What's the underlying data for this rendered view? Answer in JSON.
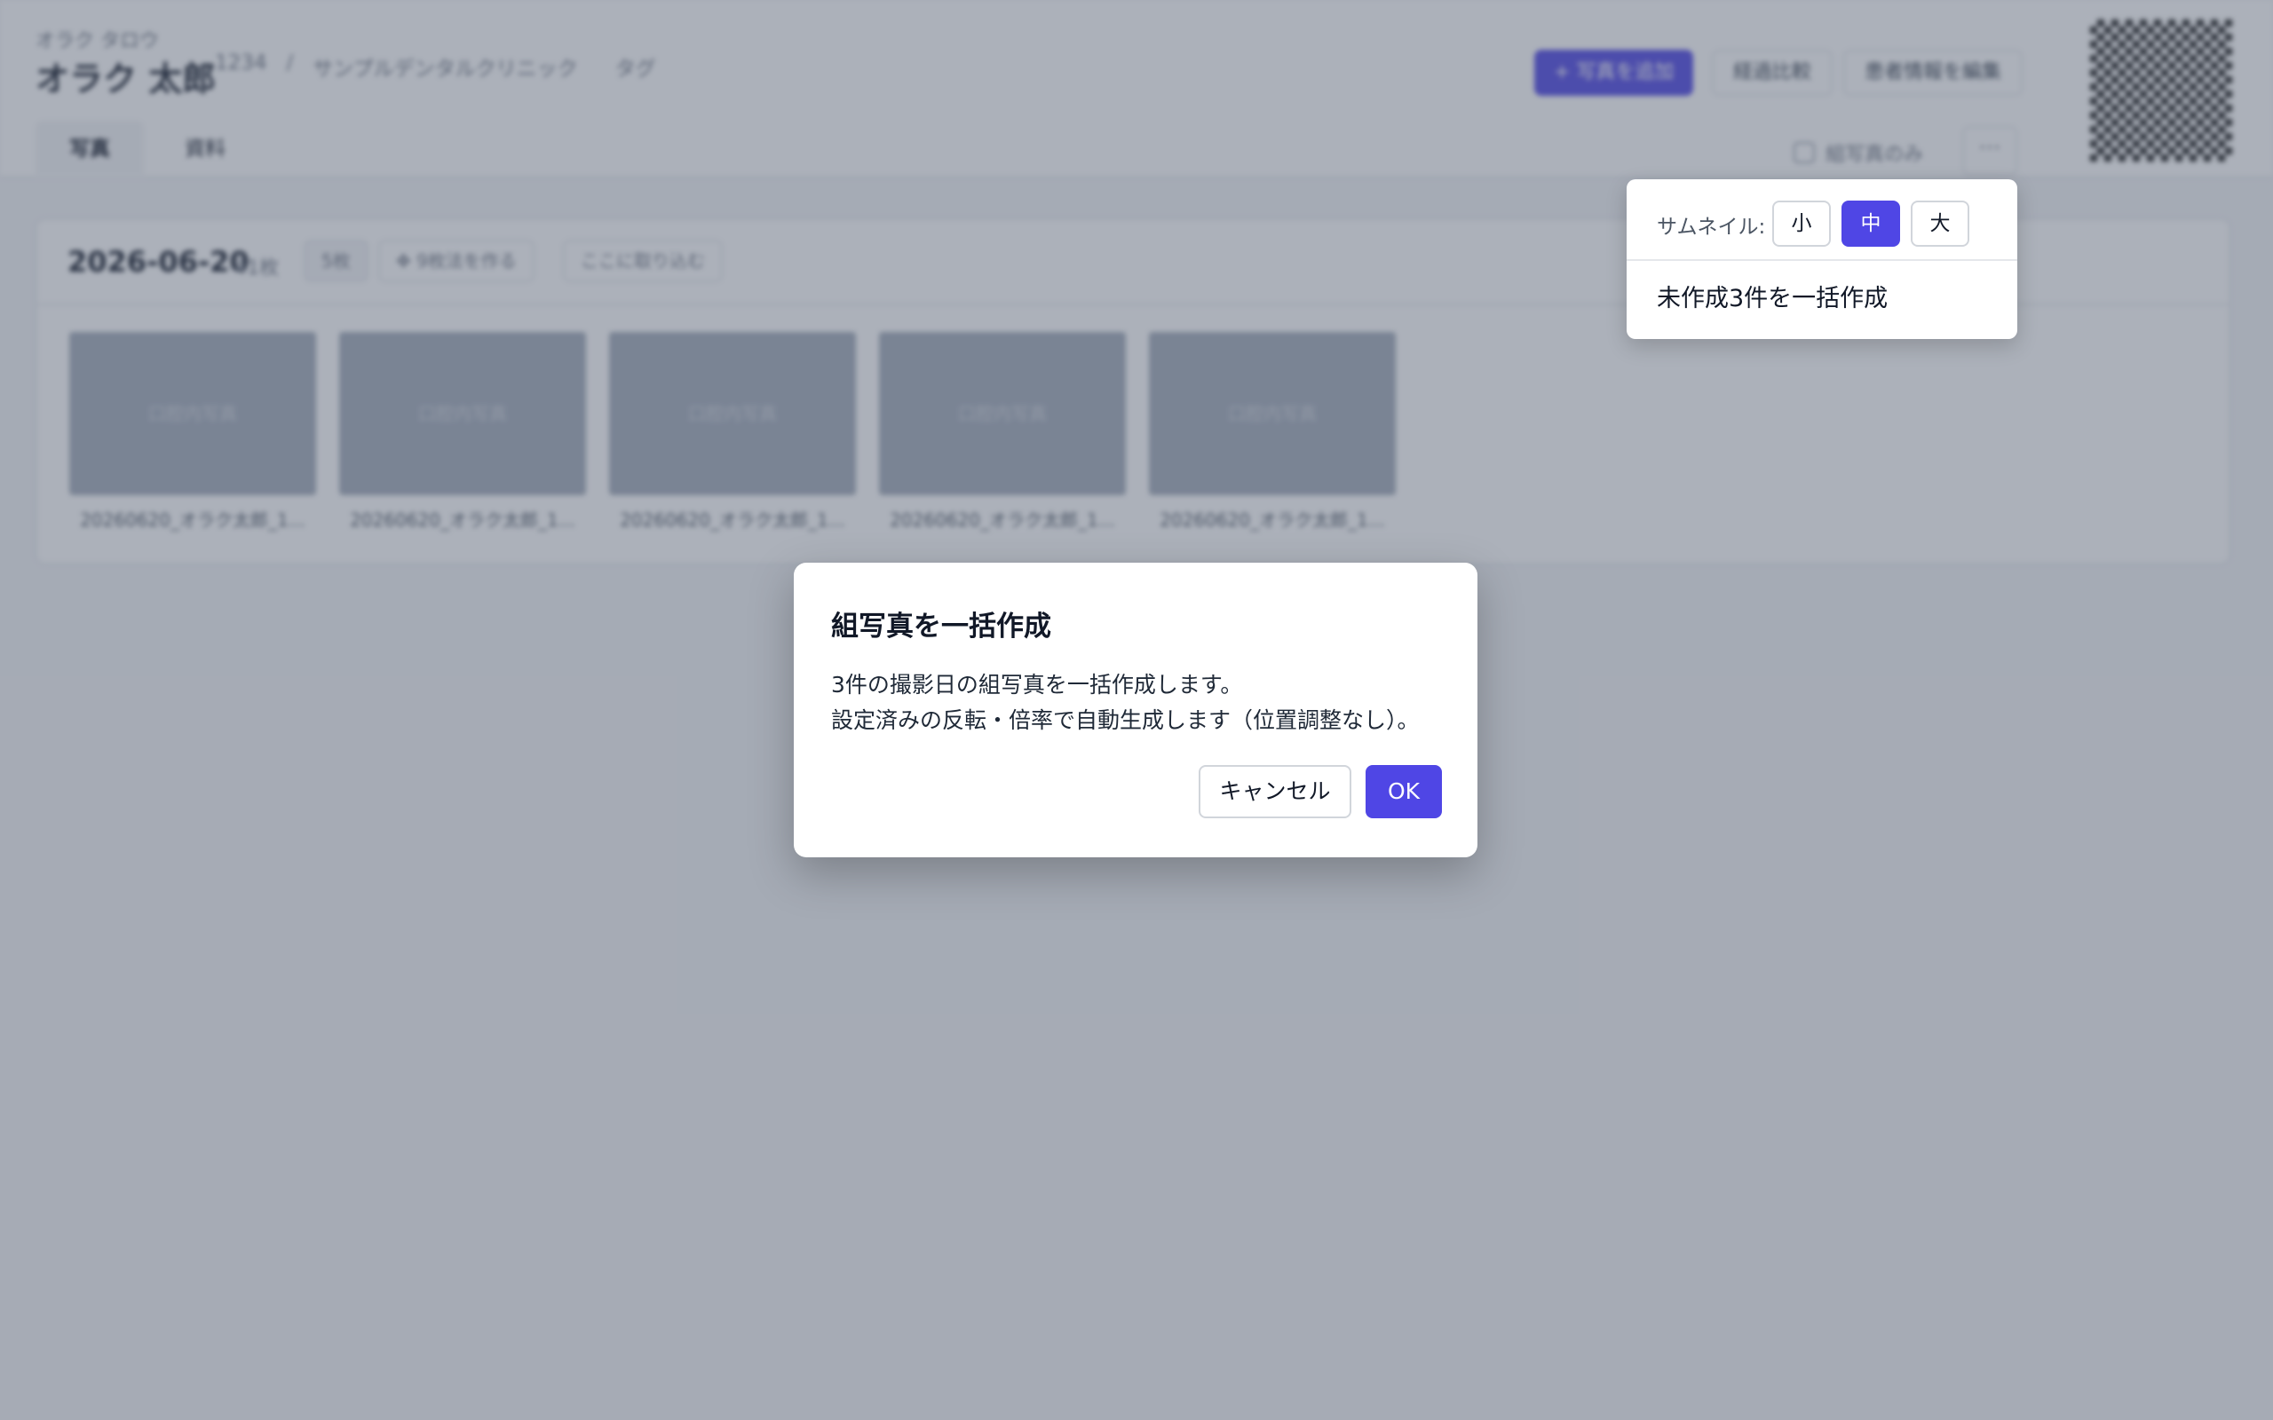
{
  "patient": {
    "kana": "オラク タロウ",
    "name": "オラク 太郎",
    "id": "1234",
    "separator": "/",
    "clinic": "サンプルデンタルクリニック",
    "tag_label": "タグ"
  },
  "header_actions": {
    "add_photo": "+ 写真を追加",
    "compare": "経過比較",
    "edit_patient": "患者情報を編集"
  },
  "tabs": [
    {
      "label": "写真",
      "active": true
    },
    {
      "label": "資料",
      "active": false
    }
  ],
  "filter": {
    "composite_only": "組写真のみ",
    "more": "···"
  },
  "photo_group": {
    "date": "2026-06-20",
    "count": "41枚",
    "chip_gray": "5枚",
    "make_composite": "✥ 9枚法を作る",
    "drop_here": "ここに取り込む",
    "thumbnails": [
      {
        "placeholder": "口腔内写真",
        "caption": "20260620_オラク太郎_1..."
      },
      {
        "placeholder": "口腔内写真",
        "caption": "20260620_オラク太郎_1..."
      },
      {
        "placeholder": "口腔内写真",
        "caption": "20260620_オラク太郎_1..."
      },
      {
        "placeholder": "口腔内写真",
        "caption": "20260620_オラク太郎_1..."
      },
      {
        "placeholder": "口腔内写真",
        "caption": "20260620_オラク太郎_1..."
      }
    ]
  },
  "dropdown": {
    "thumbnail_label": "サムネイル:",
    "sizes": [
      {
        "label": "小",
        "active": false
      },
      {
        "label": "中",
        "active": true
      },
      {
        "label": "大",
        "active": false
      }
    ],
    "bulk_create": "未作成3件を一括作成"
  },
  "modal": {
    "title": "組写真を一括作成",
    "line1": "3件の撮影日の組写真を一括作成します。",
    "line2": "設定済みの反転・倍率で自動生成します（位置調整なし）。",
    "cancel": "キャンセル",
    "ok": "OK"
  },
  "colors": {
    "primary": "#4f46e5",
    "overlay": "#4b5569"
  }
}
